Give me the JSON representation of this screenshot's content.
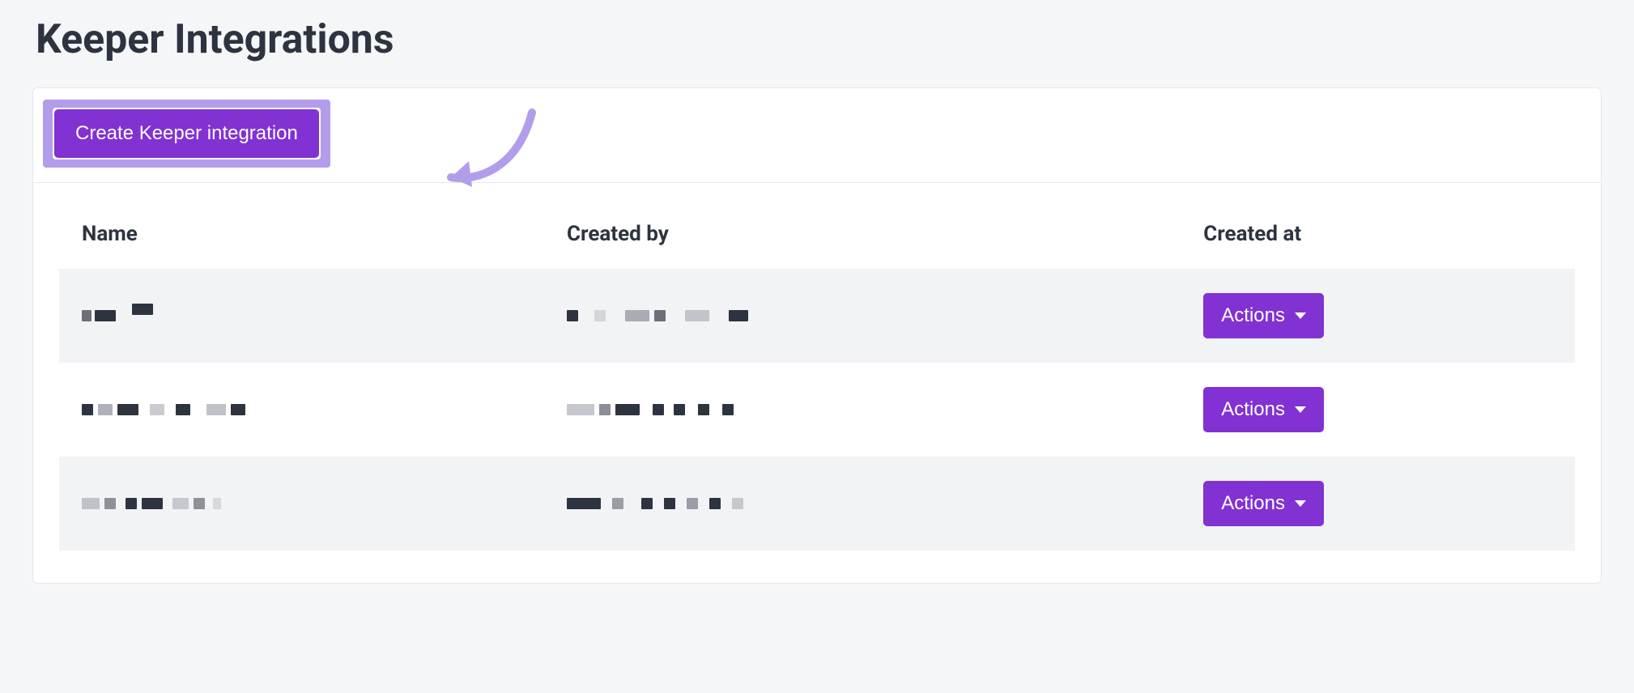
{
  "page": {
    "title": "Keeper Integrations"
  },
  "toolbar": {
    "create_label": "Create Keeper integration"
  },
  "table": {
    "columns": {
      "name": "Name",
      "created_by": "Created by",
      "created_at": "Created at"
    },
    "rows": [
      {
        "name_redacted": true,
        "created_by_redacted": true,
        "action_label": "Actions"
      },
      {
        "name_redacted": true,
        "created_by_redacted": true,
        "action_label": "Actions"
      },
      {
        "name_redacted": true,
        "created_by_redacted": true,
        "action_label": "Actions"
      }
    ]
  },
  "colors": {
    "accent": "#8231d3",
    "highlight": "#b39dea"
  }
}
